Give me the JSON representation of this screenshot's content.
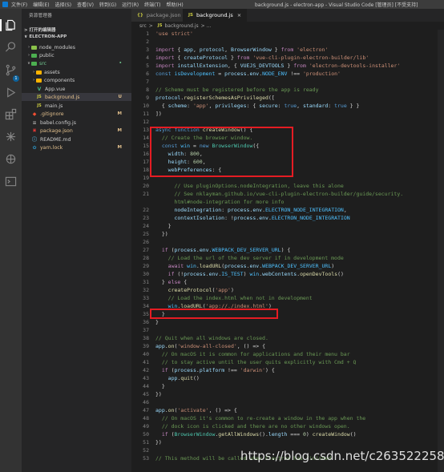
{
  "titlebar": {
    "menu": [
      "文件(F)",
      "编辑(E)",
      "选择(S)",
      "查看(V)",
      "转到(G)",
      "运行(R)",
      "终端(T)",
      "帮助(H)"
    ],
    "title": "background.js - electron-app - Visual Studio Code [管理员] [不受支持]"
  },
  "sidebar": {
    "header": "资源管理器",
    "open_editors": "> 打开的编辑器",
    "project": "ELECTRON-APP",
    "items": [
      {
        "label": "node_modules",
        "status": ""
      },
      {
        "label": "public",
        "status": ""
      },
      {
        "label": "src",
        "status": "•"
      },
      {
        "label": "assets",
        "status": ""
      },
      {
        "label": "components",
        "status": ""
      },
      {
        "label": "App.vue",
        "status": ""
      },
      {
        "label": "background.js",
        "status": "U"
      },
      {
        "label": "main.js",
        "status": ""
      },
      {
        "label": ".gitignore",
        "status": "M"
      },
      {
        "label": "babel.config.js",
        "status": ""
      },
      {
        "label": "package.json",
        "status": "M"
      },
      {
        "label": "README.md",
        "status": ""
      },
      {
        "label": "yarn.lock",
        "status": "M"
      }
    ],
    "badge": "1"
  },
  "tabs": [
    {
      "label": "package.json",
      "icon": "{}"
    },
    {
      "label": "background.js",
      "icon": "JS",
      "close": "×"
    }
  ],
  "breadcrumb": {
    "folder": "src",
    "sep": ">",
    "icon": "JS",
    "file": "background.js",
    "tail": "> ..."
  },
  "code": [
    {
      "n": "1",
      "t": [
        [
          "str",
          "'use strict'"
        ]
      ]
    },
    {
      "n": "2",
      "t": []
    },
    {
      "n": "3",
      "t": [
        [
          "ctl",
          "import"
        ],
        [
          "pl",
          " { "
        ],
        [
          "var",
          "app"
        ],
        [
          "pl",
          ", "
        ],
        [
          "var",
          "protocol"
        ],
        [
          "pl",
          ", "
        ],
        [
          "var",
          "BrowserWindow"
        ],
        [
          "pl",
          " } "
        ],
        [
          "ctl",
          "from"
        ],
        [
          "pl",
          " "
        ],
        [
          "str",
          "'electron'"
        ]
      ]
    },
    {
      "n": "4",
      "t": [
        [
          "ctl",
          "import"
        ],
        [
          "pl",
          " { "
        ],
        [
          "var",
          "createProtocol"
        ],
        [
          "pl",
          " } "
        ],
        [
          "ctl",
          "from"
        ],
        [
          "pl",
          " "
        ],
        [
          "str",
          "'vue-cli-plugin-electron-builder/lib'"
        ]
      ]
    },
    {
      "n": "5",
      "t": [
        [
          "ctl",
          "import"
        ],
        [
          "pl",
          " "
        ],
        [
          "var",
          "installExtension"
        ],
        [
          "pl",
          ", { "
        ],
        [
          "var",
          "VUEJS_DEVTOOLS"
        ],
        [
          "pl",
          " } "
        ],
        [
          "ctl",
          "from"
        ],
        [
          "pl",
          " "
        ],
        [
          "str",
          "'electron-devtools-installer'"
        ]
      ]
    },
    {
      "n": "6",
      "t": [
        [
          "kw",
          "const"
        ],
        [
          "pl",
          " "
        ],
        [
          "cst",
          "isDevelopment"
        ],
        [
          "pl",
          " = "
        ],
        [
          "var",
          "process"
        ],
        [
          "pl",
          "."
        ],
        [
          "var",
          "env"
        ],
        [
          "pl",
          "."
        ],
        [
          "cst",
          "NODE_ENV"
        ],
        [
          "pl",
          " !== "
        ],
        [
          "str",
          "'production'"
        ]
      ]
    },
    {
      "n": "7",
      "t": []
    },
    {
      "n": "8",
      "t": [
        [
          "cmt",
          "// Scheme must be registered before the app is ready"
        ]
      ]
    },
    {
      "n": "9",
      "t": [
        [
          "var",
          "protocol"
        ],
        [
          "pl",
          "."
        ],
        [
          "fn",
          "registerSchemesAsPrivileged"
        ],
        [
          "pl",
          "(["
        ]
      ]
    },
    {
      "n": "10",
      "t": [
        [
          "pl",
          "  { "
        ],
        [
          "var",
          "scheme"
        ],
        [
          "pl",
          ": "
        ],
        [
          "str",
          "'app'"
        ],
        [
          "pl",
          ", "
        ],
        [
          "var",
          "privileges"
        ],
        [
          "pl",
          ": { "
        ],
        [
          "var",
          "secure"
        ],
        [
          "pl",
          ": "
        ],
        [
          "kw",
          "true"
        ],
        [
          "pl",
          ", "
        ],
        [
          "var",
          "standard"
        ],
        [
          "pl",
          ": "
        ],
        [
          "kw",
          "true"
        ],
        [
          "pl",
          " } }"
        ]
      ]
    },
    {
      "n": "11",
      "t": [
        [
          "pl",
          "])"
        ]
      ]
    },
    {
      "n": "12",
      "t": []
    },
    {
      "n": "13",
      "t": [
        [
          "kw",
          "async"
        ],
        [
          "pl",
          " "
        ],
        [
          "kw",
          "function"
        ],
        [
          "pl",
          " "
        ],
        [
          "fn",
          "createWindow"
        ],
        [
          "pl",
          "() {"
        ]
      ]
    },
    {
      "n": "14",
      "t": [
        [
          "cmt",
          "  // Create the browser window."
        ]
      ]
    },
    {
      "n": "15",
      "t": [
        [
          "pl",
          "  "
        ],
        [
          "kw",
          "const"
        ],
        [
          "pl",
          " "
        ],
        [
          "cst",
          "win"
        ],
        [
          "pl",
          " = "
        ],
        [
          "kw",
          "new"
        ],
        [
          "pl",
          " "
        ],
        [
          "cls",
          "BrowserWindow"
        ],
        [
          "pl",
          "({"
        ]
      ]
    },
    {
      "n": "16",
      "t": [
        [
          "pl",
          "    "
        ],
        [
          "var",
          "width"
        ],
        [
          "pl",
          ": "
        ],
        [
          "num",
          "800"
        ],
        [
          "pl",
          ","
        ]
      ]
    },
    {
      "n": "17",
      "t": [
        [
          "pl",
          "    "
        ],
        [
          "var",
          "height"
        ],
        [
          "pl",
          ": "
        ],
        [
          "num",
          "600"
        ],
        [
          "pl",
          ","
        ]
      ]
    },
    {
      "n": "18",
      "t": [
        [
          "pl",
          "    "
        ],
        [
          "var",
          "webPreferences"
        ],
        [
          "pl",
          ": {"
        ]
      ]
    },
    {
      "n": "19",
      "t": []
    },
    {
      "n": "20",
      "t": [
        [
          "cmt",
          "      // Use pluginOptions.nodeIntegration, leave this alone"
        ]
      ]
    },
    {
      "n": "21",
      "t": [
        [
          "cmt",
          "      // See nklayman.github.io/vue-cli-plugin-electron-builder/guide/security."
        ]
      ]
    },
    {
      "n": "",
      "t": [
        [
          "cmt",
          "      html#node-integration for more info"
        ]
      ]
    },
    {
      "n": "22",
      "t": [
        [
          "pl",
          "      "
        ],
        [
          "var",
          "nodeIntegration"
        ],
        [
          "pl",
          ": "
        ],
        [
          "var",
          "process"
        ],
        [
          "pl",
          "."
        ],
        [
          "var",
          "env"
        ],
        [
          "pl",
          "."
        ],
        [
          "cst",
          "ELECTRON_NODE_INTEGRATION"
        ],
        [
          "pl",
          ","
        ]
      ]
    },
    {
      "n": "23",
      "t": [
        [
          "pl",
          "      "
        ],
        [
          "var",
          "contextIsolation"
        ],
        [
          "pl",
          ": !"
        ],
        [
          "var",
          "process"
        ],
        [
          "pl",
          "."
        ],
        [
          "var",
          "env"
        ],
        [
          "pl",
          "."
        ],
        [
          "cst",
          "ELECTRON_NODE_INTEGRATION"
        ]
      ]
    },
    {
      "n": "24",
      "t": [
        [
          "pl",
          "    }"
        ]
      ]
    },
    {
      "n": "25",
      "t": [
        [
          "pl",
          "  })"
        ]
      ]
    },
    {
      "n": "26",
      "t": []
    },
    {
      "n": "27",
      "t": [
        [
          "pl",
          "  "
        ],
        [
          "ctl",
          "if"
        ],
        [
          "pl",
          " ("
        ],
        [
          "var",
          "process"
        ],
        [
          "pl",
          "."
        ],
        [
          "var",
          "env"
        ],
        [
          "pl",
          "."
        ],
        [
          "cst",
          "WEBPACK_DEV_SERVER_URL"
        ],
        [
          "pl",
          ") {"
        ]
      ]
    },
    {
      "n": "28",
      "t": [
        [
          "cmt",
          "    // Load the url of the dev server if in development mode"
        ]
      ]
    },
    {
      "n": "29",
      "t": [
        [
          "pl",
          "    "
        ],
        [
          "ctl",
          "await"
        ],
        [
          "pl",
          " "
        ],
        [
          "cst",
          "win"
        ],
        [
          "pl",
          "."
        ],
        [
          "fn",
          "loadURL"
        ],
        [
          "pl",
          "("
        ],
        [
          "var",
          "process"
        ],
        [
          "pl",
          "."
        ],
        [
          "var",
          "env"
        ],
        [
          "pl",
          "."
        ],
        [
          "cst",
          "WEBPACK_DEV_SERVER_URL"
        ],
        [
          "pl",
          ")"
        ]
      ]
    },
    {
      "n": "30",
      "t": [
        [
          "pl",
          "    "
        ],
        [
          "ctl",
          "if"
        ],
        [
          "pl",
          " (!"
        ],
        [
          "var",
          "process"
        ],
        [
          "pl",
          "."
        ],
        [
          "var",
          "env"
        ],
        [
          "pl",
          "."
        ],
        [
          "cst",
          "IS_TEST"
        ],
        [
          "pl",
          ") "
        ],
        [
          "cst",
          "win"
        ],
        [
          "pl",
          "."
        ],
        [
          "var",
          "webContents"
        ],
        [
          "pl",
          "."
        ],
        [
          "fn",
          "openDevTools"
        ],
        [
          "pl",
          "()"
        ]
      ]
    },
    {
      "n": "31",
      "t": [
        [
          "pl",
          "  } "
        ],
        [
          "ctl",
          "else"
        ],
        [
          "pl",
          " {"
        ]
      ]
    },
    {
      "n": "32",
      "t": [
        [
          "pl",
          "    "
        ],
        [
          "fn",
          "createProtocol"
        ],
        [
          "pl",
          "("
        ],
        [
          "str",
          "'app'"
        ],
        [
          "pl",
          ")"
        ]
      ]
    },
    {
      "n": "33",
      "t": [
        [
          "cmt",
          "    // Load the index.html when not in development"
        ]
      ]
    },
    {
      "n": "34",
      "t": [
        [
          "pl",
          "    "
        ],
        [
          "cst",
          "win"
        ],
        [
          "pl",
          "."
        ],
        [
          "fn",
          "loadURL"
        ],
        [
          "pl",
          "("
        ],
        [
          "str",
          "'app://./index.html'"
        ],
        [
          "pl",
          ")"
        ]
      ]
    },
    {
      "n": "35",
      "t": [
        [
          "pl",
          "  }"
        ]
      ]
    },
    {
      "n": "36",
      "t": [
        [
          "pl",
          "}"
        ]
      ]
    },
    {
      "n": "37",
      "t": []
    },
    {
      "n": "38",
      "t": [
        [
          "cmt",
          "// Quit when all windows are closed."
        ]
      ]
    },
    {
      "n": "39",
      "t": [
        [
          "var",
          "app"
        ],
        [
          "pl",
          "."
        ],
        [
          "fn",
          "on"
        ],
        [
          "pl",
          "("
        ],
        [
          "str",
          "'window-all-closed'"
        ],
        [
          "pl",
          ", () => {"
        ]
      ]
    },
    {
      "n": "40",
      "t": [
        [
          "cmt",
          "  // On macOS it is common for applications and their menu bar"
        ]
      ]
    },
    {
      "n": "41",
      "t": [
        [
          "cmt",
          "  // to stay active until the user quits explicitly with Cmd + Q"
        ]
      ]
    },
    {
      "n": "42",
      "t": [
        [
          "pl",
          "  "
        ],
        [
          "ctl",
          "if"
        ],
        [
          "pl",
          " ("
        ],
        [
          "var",
          "process"
        ],
        [
          "pl",
          "."
        ],
        [
          "var",
          "platform"
        ],
        [
          "pl",
          " !== "
        ],
        [
          "str",
          "'darwin'"
        ],
        [
          "pl",
          ") {"
        ]
      ]
    },
    {
      "n": "43",
      "t": [
        [
          "pl",
          "    "
        ],
        [
          "var",
          "app"
        ],
        [
          "pl",
          "."
        ],
        [
          "fn",
          "quit"
        ],
        [
          "pl",
          "()"
        ]
      ]
    },
    {
      "n": "44",
      "t": [
        [
          "pl",
          "  }"
        ]
      ]
    },
    {
      "n": "45",
      "t": [
        [
          "pl",
          "})"
        ]
      ]
    },
    {
      "n": "46",
      "t": []
    },
    {
      "n": "47",
      "t": [
        [
          "var",
          "app"
        ],
        [
          "pl",
          "."
        ],
        [
          "fn",
          "on"
        ],
        [
          "pl",
          "("
        ],
        [
          "str",
          "'activate'"
        ],
        [
          "pl",
          ", () => {"
        ]
      ]
    },
    {
      "n": "48",
      "t": [
        [
          "cmt",
          "  // On macOS it's common to re-create a window in the app when the"
        ]
      ]
    },
    {
      "n": "49",
      "t": [
        [
          "cmt",
          "  // dock icon is clicked and there are no other windows open."
        ]
      ]
    },
    {
      "n": "50",
      "t": [
        [
          "pl",
          "  "
        ],
        [
          "ctl",
          "if"
        ],
        [
          "pl",
          " ("
        ],
        [
          "cls",
          "BrowserWindow"
        ],
        [
          "pl",
          "."
        ],
        [
          "fn",
          "getAllWindows"
        ],
        [
          "pl",
          "()."
        ],
        [
          "var",
          "length"
        ],
        [
          "pl",
          " === "
        ],
        [
          "num",
          "0"
        ],
        [
          "pl",
          ") "
        ],
        [
          "fn",
          "createWindow"
        ],
        [
          "pl",
          "()"
        ]
      ]
    },
    {
      "n": "51",
      "t": [
        [
          "pl",
          "})"
        ]
      ]
    },
    {
      "n": "52",
      "t": []
    },
    {
      "n": "53",
      "t": [
        [
          "cmt",
          "// This method will be called when Electron has finished"
        ]
      ]
    }
  ],
  "watermark": "https://blog.csdn.net/c2635222586",
  "colors": {
    "highlight_box": "#e51c23",
    "accent": "#0e639c"
  }
}
